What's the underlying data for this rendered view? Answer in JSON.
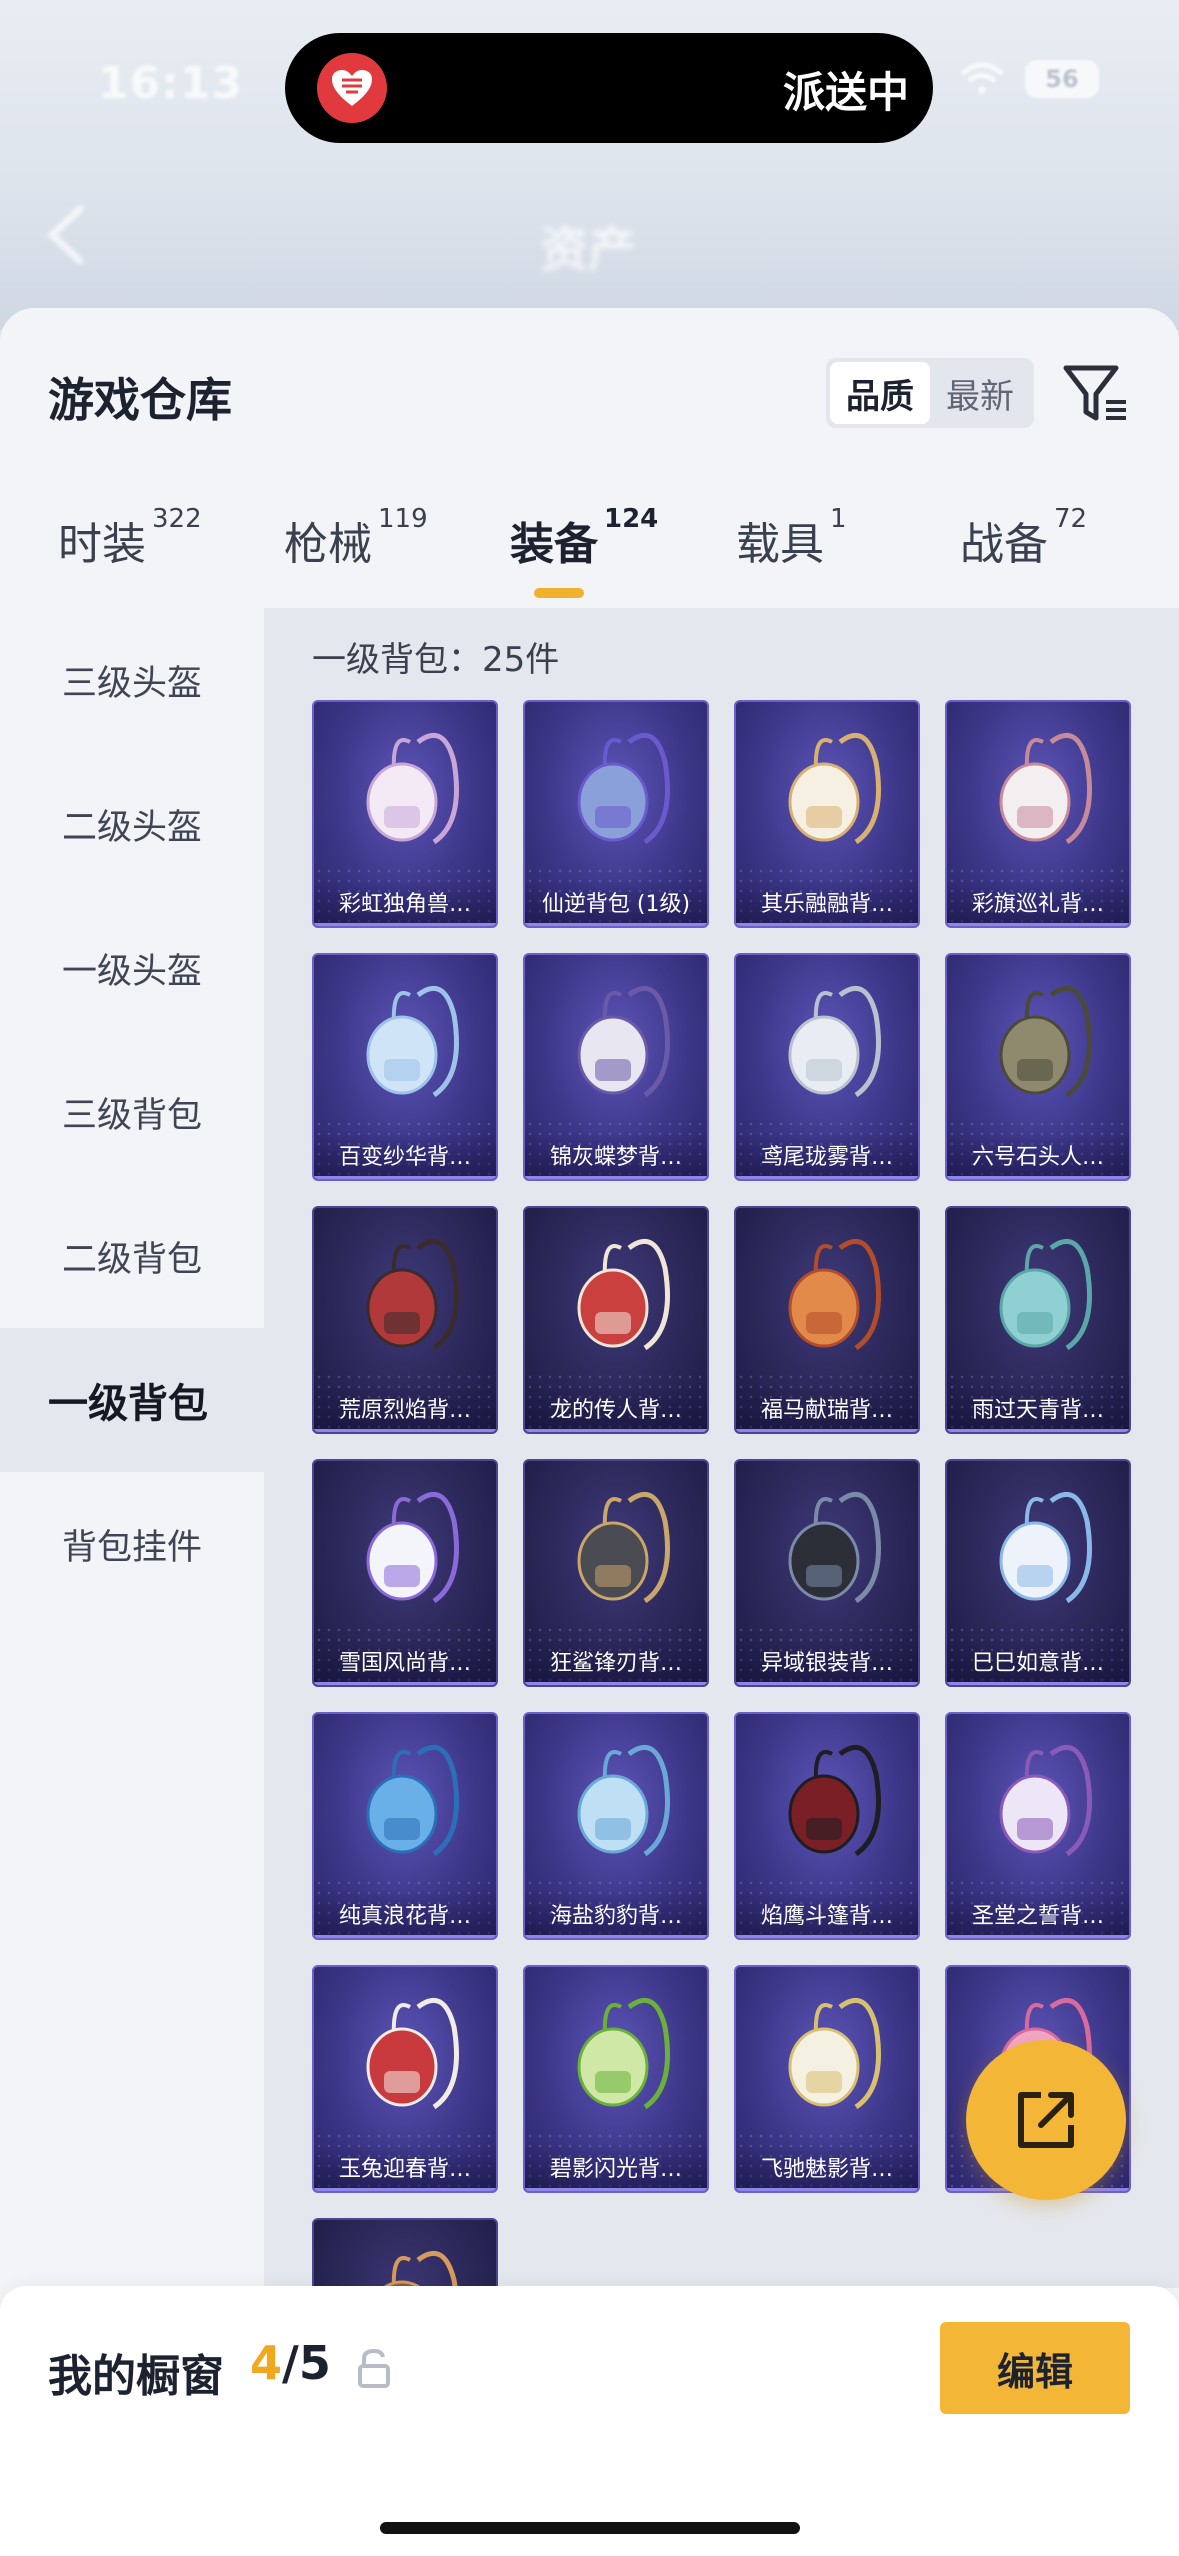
{
  "status_bar": {
    "time": "16:13",
    "island_text": "派送中",
    "battery": "56"
  },
  "nav": {
    "title": "资产"
  },
  "sheet": {
    "title": "游戏仓库",
    "sort_options": [
      "品质",
      "最新"
    ],
    "active_sort": "品质"
  },
  "tabs": [
    {
      "label": "时装",
      "count": "322"
    },
    {
      "label": "枪械",
      "count": "119"
    },
    {
      "label": "装备",
      "count": "124"
    },
    {
      "label": "载具",
      "count": "1"
    },
    {
      "label": "战备",
      "count": "72"
    }
  ],
  "active_tab": "装备",
  "sidebar": {
    "items": [
      "三级头盔",
      "二级头盔",
      "一级头盔",
      "三级背包",
      "二级背包",
      "一级背包",
      "背包挂件"
    ],
    "active": "一级背包"
  },
  "grid": {
    "heading": "一级背包：25件",
    "items": [
      "彩虹独角兽…",
      "仙逆背包 (1级)",
      "其乐融融背…",
      "彩旗巡礼背…",
      "百变纱华背…",
      "锦灰蝶梦背…",
      "鸢尾珑雾背…",
      "六号石头人…",
      "荒原烈焰背…",
      "龙的传人背…",
      "福马献瑞背…",
      "雨过天青背…",
      "雪国风尚背…",
      "狂鲨锋刃背…",
      "异域银装背…",
      "巳巳如意背…",
      "纯真浪花背…",
      "海盐豹豹背…",
      "焰鹰斗篷背…",
      "圣堂之誓背…",
      "玉兔迎春背…",
      "碧影闪光背…",
      "飞驰魅影背…",
      "",
      ""
    ]
  },
  "bottom_bar": {
    "title": "我的橱窗",
    "current": "4",
    "total": "/5",
    "edit_label": "编辑"
  },
  "colors": {
    "accent": "#f3b637",
    "card_purple": "#3d3789",
    "active_underline": "#f2b12c"
  }
}
